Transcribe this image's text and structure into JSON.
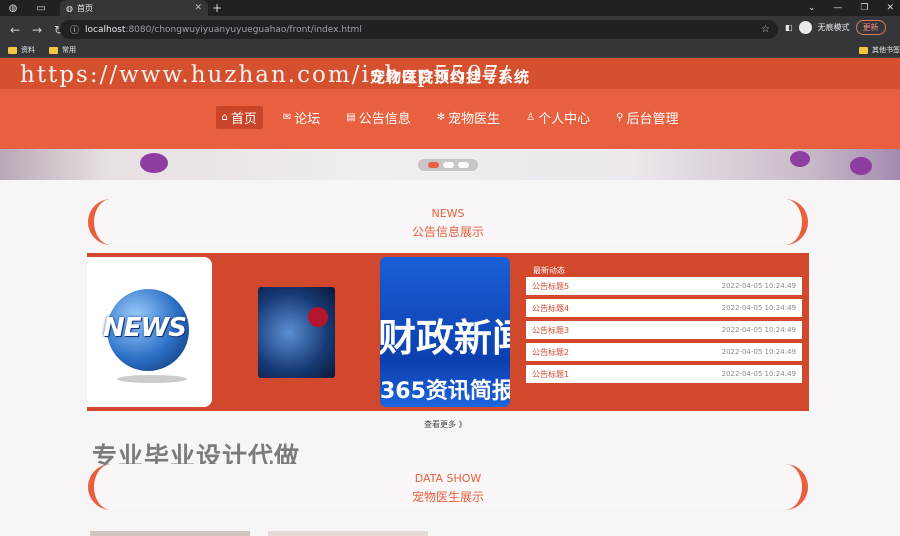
{
  "browser": {
    "tab_title": "首页",
    "url_host": "localhost",
    "url_path": ":8080/chongwuyiyuanyuyueguahao/front/index.html",
    "incognito_label": "无痕模式",
    "update_label": "更新",
    "bookmarks": [
      "资料",
      "常用"
    ],
    "other_bookmarks": "其他书签"
  },
  "site": {
    "title": "宠物医院预约挂号系统",
    "watermark": "https://www.huzhan.com/ishop5597/",
    "menu": [
      {
        "label": "首页",
        "icon": "home-icon",
        "active": true
      },
      {
        "label": "论坛",
        "icon": "mail-icon",
        "active": false
      },
      {
        "label": "公告信息",
        "icon": "doc-icon",
        "active": false
      },
      {
        "label": "宠物医生",
        "icon": "flower-icon",
        "active": false
      },
      {
        "label": "个人中心",
        "icon": "user-icon",
        "active": false
      },
      {
        "label": "后台管理",
        "icon": "link-icon",
        "active": false
      }
    ]
  },
  "news_section": {
    "en": "NEWS",
    "cn": "公告信息展示",
    "image1_text": "NEWS",
    "image3_text1": "财政新闻",
    "image3_text2": "365资讯简报",
    "latest_label": "最新动态",
    "items": [
      {
        "title": "公告标题5",
        "date": "2022-04-05 10:24:49"
      },
      {
        "title": "公告标题4",
        "date": "2022-04-05 10:24:49"
      },
      {
        "title": "公告标题3",
        "date": "2022-04-05 10:24:49"
      },
      {
        "title": "公告标题2",
        "date": "2022-04-05 10:24:49"
      },
      {
        "title": "公告标题1",
        "date": "2022-04-05 10:24:49"
      }
    ],
    "more_label": "查看更多 》"
  },
  "promo_text": "专业毕业设计代做",
  "data_section": {
    "en": "DATA SHOW",
    "cn": "宠物医生展示"
  },
  "colors": {
    "accent": "#e8603f",
    "accent_dark": "#d1482c"
  }
}
